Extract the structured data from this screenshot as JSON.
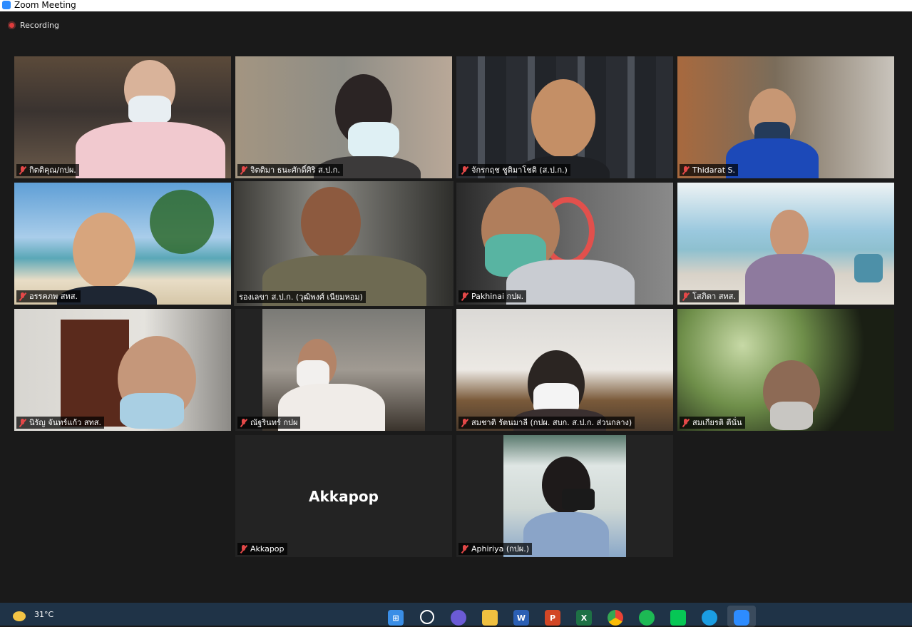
{
  "window": {
    "title": "Zoom Meeting",
    "recording_label": "Recording"
  },
  "participants": [
    {
      "name": "กิตติคุณ/กปผ."
    },
    {
      "name": "จิตติมา  ธนะศักดิ์ศิริ ส.ป.ก."
    },
    {
      "name": "จักรกฤช ชูติมาโชติ (ส.ป.ก.)"
    },
    {
      "name": "Thidarat S."
    },
    {
      "name": "อรรคภพ สทส."
    },
    {
      "name": "รองเลขา ส.ป.ก. (วุฒิพงศ์ เนียมหอม)"
    },
    {
      "name": "Pakhinai กปผ."
    },
    {
      "name": "โสภิตา สทส."
    },
    {
      "name": "นิรัญ จันทร์แก้ว สทส."
    },
    {
      "name": "ณัฐรินทร์ กปผ"
    },
    {
      "name": "สมชาติ รัตนมาลี (กปผ. สบก. ส.ป.ก. ส่วนกลาง)"
    },
    {
      "name": "สมเกียรติ ตีนั่น"
    },
    {
      "name": "Akkapop",
      "camera_off_label": "Akkapop"
    },
    {
      "name": "Aphiriya (กปผ.)"
    }
  ],
  "taskbar": {
    "temperature": "31°C"
  },
  "colors": {
    "active_speaker_border": "#dfe67a",
    "muted_mic": "#e34848",
    "taskbar_bg": "#1f3347"
  }
}
